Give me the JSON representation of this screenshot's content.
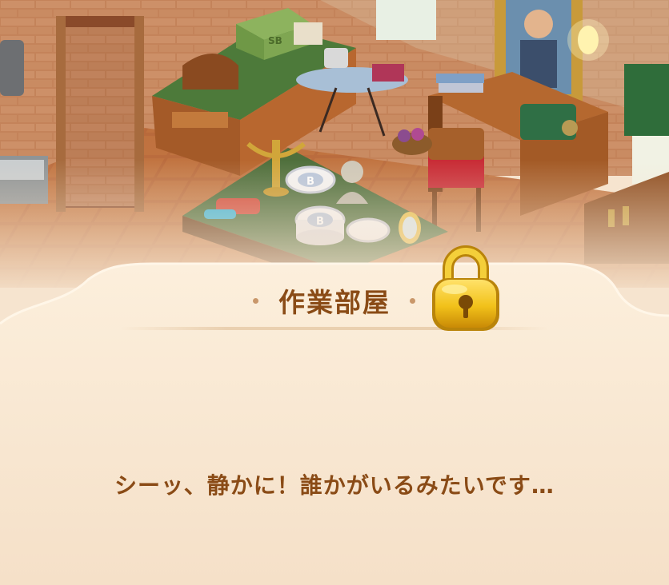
{
  "room": {
    "title": "作業部屋",
    "message": "シーッ、静かに！誰かがいるみたいです…",
    "locked": true
  },
  "scene_props": {
    "box_monogram": "SB",
    "plate_monogram": "B"
  },
  "colors": {
    "panel_bg": "#f6e4cf",
    "text_brown": "#8a4b16",
    "lock_gold": "#f2c21a"
  },
  "icons": {
    "lock": "padlock-icon"
  }
}
